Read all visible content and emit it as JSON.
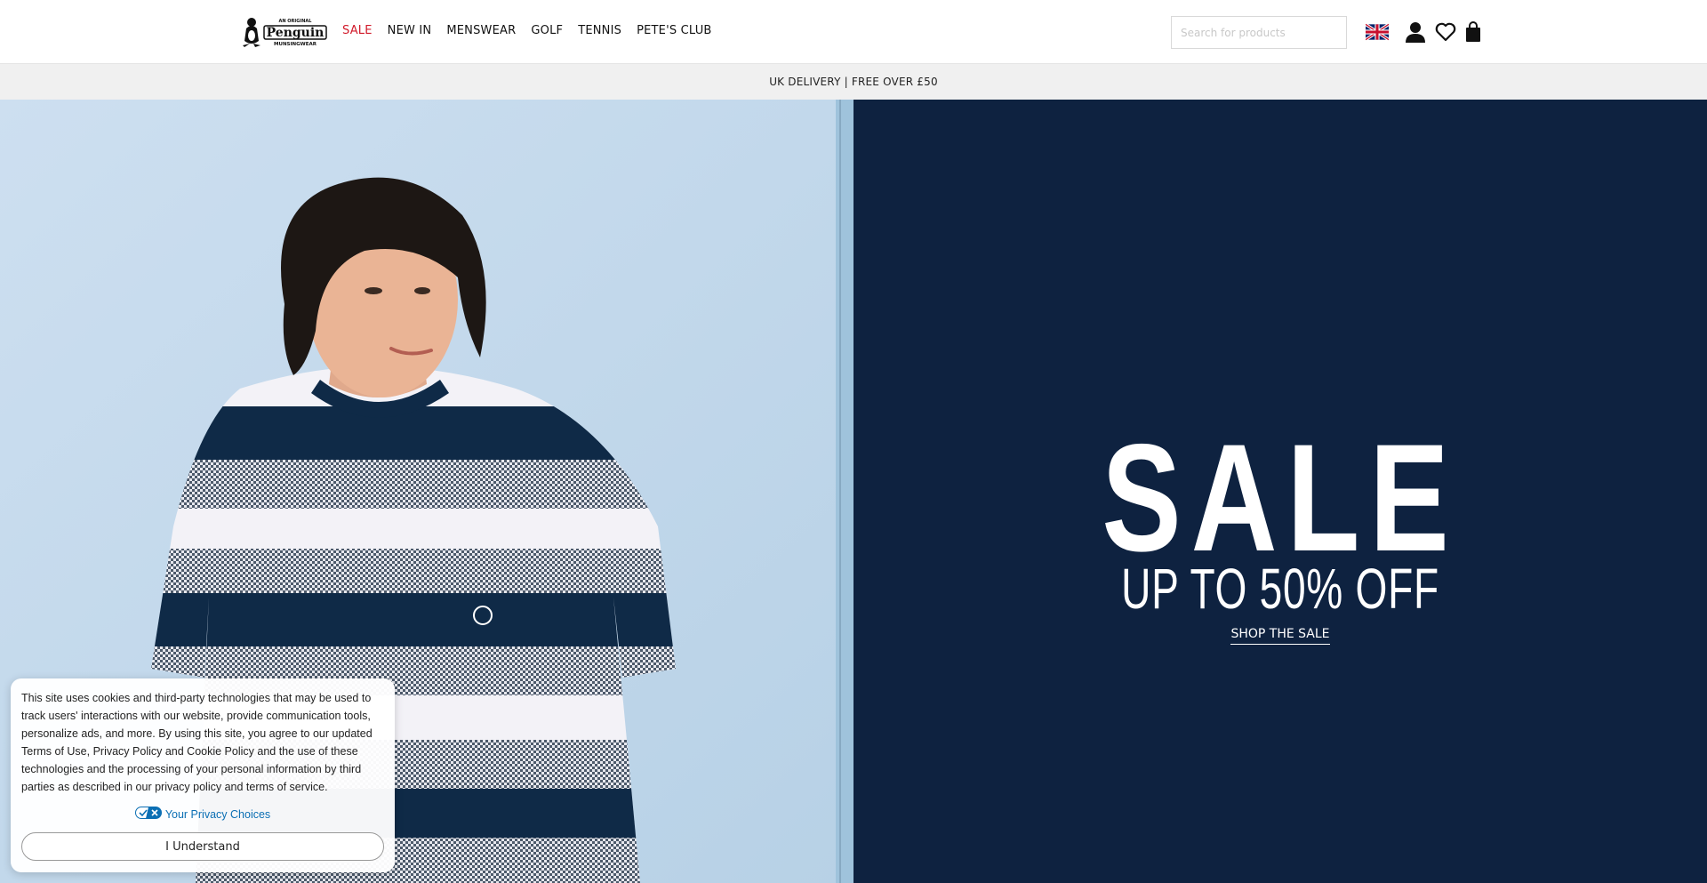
{
  "header": {
    "logo_alt": "An Original Penguin Munsingwear",
    "nav": [
      "SALE",
      "NEW IN",
      "MENSWEAR",
      "GOLF",
      "TENNIS",
      "PETE'S CLUB"
    ],
    "search_placeholder": "Search for products"
  },
  "promo": {
    "text": "UK DELIVERY | FREE OVER £50"
  },
  "hero": {
    "headline": "SALE",
    "subheadline": "UP TO 50% OFF",
    "cta": "SHOP THE SALE"
  },
  "cookie": {
    "text": "This site uses cookies and third-party technologies that may be used to track users' interactions with our website, provide communication tools, personalize ads, and more. By using this site, you agree to our updated Terms of Use, Privacy Policy and Cookie Policy and the use of these technologies and the processing of your personal information by third parties as described in our privacy policy and terms of service.",
    "privacy_choices": "Your Privacy Choices",
    "button": "I Understand"
  },
  "colors": {
    "navy": "#0e2240",
    "sale_red": "#d11a2a",
    "promo_bg": "#f0f0f0"
  }
}
